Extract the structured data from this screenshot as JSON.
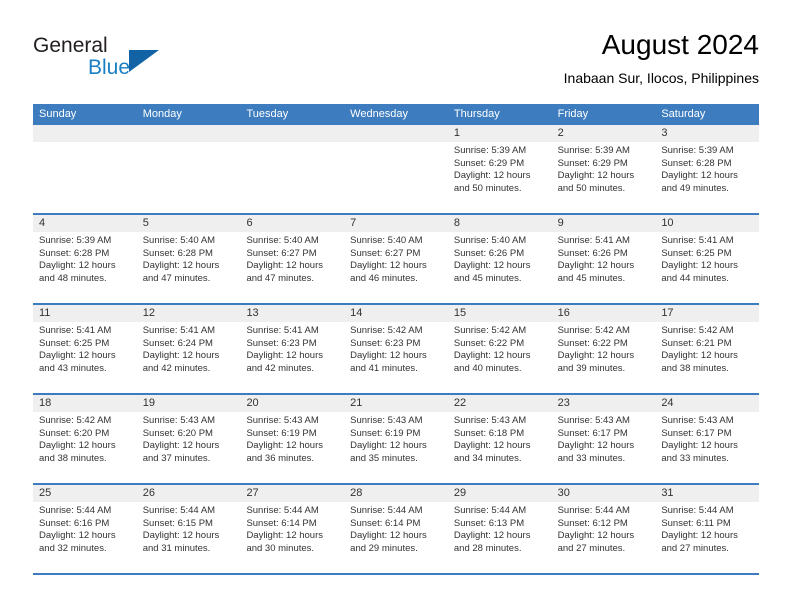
{
  "brand": {
    "name_part1": "General",
    "name_part2": "Blue",
    "logo_icon": "triangle-icon"
  },
  "header": {
    "month_title": "August 2024",
    "location": "Inabaan Sur, Ilocos, Philippines"
  },
  "colors": {
    "header_blue": "#3d7dbf",
    "brand_blue": "#1b7fc4",
    "logo_blue": "#1163a5",
    "day_band_gray": "#efefef",
    "text": "#333333"
  },
  "weekdays": [
    "Sunday",
    "Monday",
    "Tuesday",
    "Wednesday",
    "Thursday",
    "Friday",
    "Saturday"
  ],
  "weeks": [
    [
      {
        "day": "",
        "lines": []
      },
      {
        "day": "",
        "lines": []
      },
      {
        "day": "",
        "lines": []
      },
      {
        "day": "",
        "lines": []
      },
      {
        "day": "1",
        "lines": [
          "Sunrise: 5:39 AM",
          "Sunset: 6:29 PM",
          "Daylight: 12 hours",
          "and 50 minutes."
        ]
      },
      {
        "day": "2",
        "lines": [
          "Sunrise: 5:39 AM",
          "Sunset: 6:29 PM",
          "Daylight: 12 hours",
          "and 50 minutes."
        ]
      },
      {
        "day": "3",
        "lines": [
          "Sunrise: 5:39 AM",
          "Sunset: 6:28 PM",
          "Daylight: 12 hours",
          "and 49 minutes."
        ]
      }
    ],
    [
      {
        "day": "4",
        "lines": [
          "Sunrise: 5:39 AM",
          "Sunset: 6:28 PM",
          "Daylight: 12 hours",
          "and 48 minutes."
        ]
      },
      {
        "day": "5",
        "lines": [
          "Sunrise: 5:40 AM",
          "Sunset: 6:28 PM",
          "Daylight: 12 hours",
          "and 47 minutes."
        ]
      },
      {
        "day": "6",
        "lines": [
          "Sunrise: 5:40 AM",
          "Sunset: 6:27 PM",
          "Daylight: 12 hours",
          "and 47 minutes."
        ]
      },
      {
        "day": "7",
        "lines": [
          "Sunrise: 5:40 AM",
          "Sunset: 6:27 PM",
          "Daylight: 12 hours",
          "and 46 minutes."
        ]
      },
      {
        "day": "8",
        "lines": [
          "Sunrise: 5:40 AM",
          "Sunset: 6:26 PM",
          "Daylight: 12 hours",
          "and 45 minutes."
        ]
      },
      {
        "day": "9",
        "lines": [
          "Sunrise: 5:41 AM",
          "Sunset: 6:26 PM",
          "Daylight: 12 hours",
          "and 45 minutes."
        ]
      },
      {
        "day": "10",
        "lines": [
          "Sunrise: 5:41 AM",
          "Sunset: 6:25 PM",
          "Daylight: 12 hours",
          "and 44 minutes."
        ]
      }
    ],
    [
      {
        "day": "11",
        "lines": [
          "Sunrise: 5:41 AM",
          "Sunset: 6:25 PM",
          "Daylight: 12 hours",
          "and 43 minutes."
        ]
      },
      {
        "day": "12",
        "lines": [
          "Sunrise: 5:41 AM",
          "Sunset: 6:24 PM",
          "Daylight: 12 hours",
          "and 42 minutes."
        ]
      },
      {
        "day": "13",
        "lines": [
          "Sunrise: 5:41 AM",
          "Sunset: 6:23 PM",
          "Daylight: 12 hours",
          "and 42 minutes."
        ]
      },
      {
        "day": "14",
        "lines": [
          "Sunrise: 5:42 AM",
          "Sunset: 6:23 PM",
          "Daylight: 12 hours",
          "and 41 minutes."
        ]
      },
      {
        "day": "15",
        "lines": [
          "Sunrise: 5:42 AM",
          "Sunset: 6:22 PM",
          "Daylight: 12 hours",
          "and 40 minutes."
        ]
      },
      {
        "day": "16",
        "lines": [
          "Sunrise: 5:42 AM",
          "Sunset: 6:22 PM",
          "Daylight: 12 hours",
          "and 39 minutes."
        ]
      },
      {
        "day": "17",
        "lines": [
          "Sunrise: 5:42 AM",
          "Sunset: 6:21 PM",
          "Daylight: 12 hours",
          "and 38 minutes."
        ]
      }
    ],
    [
      {
        "day": "18",
        "lines": [
          "Sunrise: 5:42 AM",
          "Sunset: 6:20 PM",
          "Daylight: 12 hours",
          "and 38 minutes."
        ]
      },
      {
        "day": "19",
        "lines": [
          "Sunrise: 5:43 AM",
          "Sunset: 6:20 PM",
          "Daylight: 12 hours",
          "and 37 minutes."
        ]
      },
      {
        "day": "20",
        "lines": [
          "Sunrise: 5:43 AM",
          "Sunset: 6:19 PM",
          "Daylight: 12 hours",
          "and 36 minutes."
        ]
      },
      {
        "day": "21",
        "lines": [
          "Sunrise: 5:43 AM",
          "Sunset: 6:19 PM",
          "Daylight: 12 hours",
          "and 35 minutes."
        ]
      },
      {
        "day": "22",
        "lines": [
          "Sunrise: 5:43 AM",
          "Sunset: 6:18 PM",
          "Daylight: 12 hours",
          "and 34 minutes."
        ]
      },
      {
        "day": "23",
        "lines": [
          "Sunrise: 5:43 AM",
          "Sunset: 6:17 PM",
          "Daylight: 12 hours",
          "and 33 minutes."
        ]
      },
      {
        "day": "24",
        "lines": [
          "Sunrise: 5:43 AM",
          "Sunset: 6:17 PM",
          "Daylight: 12 hours",
          "and 33 minutes."
        ]
      }
    ],
    [
      {
        "day": "25",
        "lines": [
          "Sunrise: 5:44 AM",
          "Sunset: 6:16 PM",
          "Daylight: 12 hours",
          "and 32 minutes."
        ]
      },
      {
        "day": "26",
        "lines": [
          "Sunrise: 5:44 AM",
          "Sunset: 6:15 PM",
          "Daylight: 12 hours",
          "and 31 minutes."
        ]
      },
      {
        "day": "27",
        "lines": [
          "Sunrise: 5:44 AM",
          "Sunset: 6:14 PM",
          "Daylight: 12 hours",
          "and 30 minutes."
        ]
      },
      {
        "day": "28",
        "lines": [
          "Sunrise: 5:44 AM",
          "Sunset: 6:14 PM",
          "Daylight: 12 hours",
          "and 29 minutes."
        ]
      },
      {
        "day": "29",
        "lines": [
          "Sunrise: 5:44 AM",
          "Sunset: 6:13 PM",
          "Daylight: 12 hours",
          "and 28 minutes."
        ]
      },
      {
        "day": "30",
        "lines": [
          "Sunrise: 5:44 AM",
          "Sunset: 6:12 PM",
          "Daylight: 12 hours",
          "and 27 minutes."
        ]
      },
      {
        "day": "31",
        "lines": [
          "Sunrise: 5:44 AM",
          "Sunset: 6:11 PM",
          "Daylight: 12 hours",
          "and 27 minutes."
        ]
      }
    ]
  ]
}
